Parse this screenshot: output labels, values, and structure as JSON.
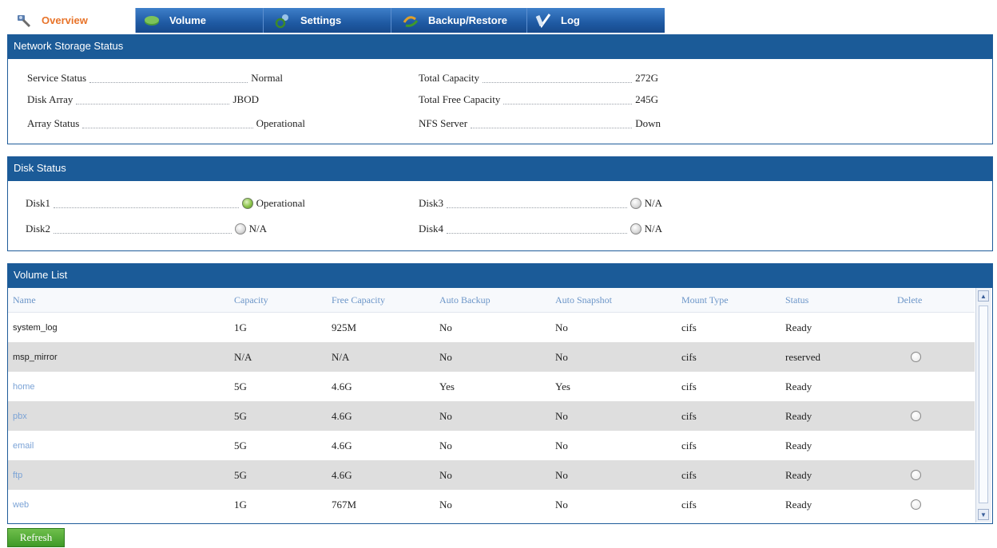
{
  "tabs": [
    {
      "label": "Overview",
      "icon": "wrench-icon",
      "active": true
    },
    {
      "label": "Volume",
      "icon": "disk-icon",
      "active": false
    },
    {
      "label": "Settings",
      "icon": "gears-icon",
      "active": false
    },
    {
      "label": "Backup/Restore",
      "icon": "arrows-icon",
      "active": false
    },
    {
      "label": "Log",
      "icon": "checkmark-icon",
      "active": false
    }
  ],
  "network": {
    "title": "Network Storage Status",
    "service_status": {
      "label": "Service Status",
      "value": "Normal"
    },
    "disk_array": {
      "label": "Disk Array",
      "value": "JBOD"
    },
    "array_status": {
      "label": "Array Status",
      "value": "Operational"
    },
    "total_capacity": {
      "label": "Total Capacity",
      "value": "272G"
    },
    "total_free": {
      "label": "Total Free Capacity",
      "value": "245G"
    },
    "nfs_server": {
      "label": "NFS Server",
      "value": "Down"
    }
  },
  "disks": {
    "title": "Disk Status",
    "disk1": {
      "label": "Disk1",
      "value": "Operational",
      "state": "ok"
    },
    "disk2": {
      "label": "Disk2",
      "value": "N/A",
      "state": "na"
    },
    "disk3": {
      "label": "Disk3",
      "value": "N/A",
      "state": "na"
    },
    "disk4": {
      "label": "Disk4",
      "value": "N/A",
      "state": "na"
    }
  },
  "volumes": {
    "title": "Volume List",
    "columns": [
      "Name",
      "Capacity",
      "Free Capacity",
      "Auto Backup",
      "Auto Snapshot",
      "Mount Type",
      "Status",
      "Delete"
    ],
    "rows": [
      {
        "name": "system_log",
        "capacity": "1G",
        "free": "925M",
        "backup": "No",
        "snapshot": "No",
        "mount": "cifs",
        "status": "Ready",
        "deletable": false
      },
      {
        "name": "msp_mirror",
        "capacity": "N/A",
        "free": "N/A",
        "backup": "No",
        "snapshot": "No",
        "mount": "cifs",
        "status": "reserved",
        "deletable": true
      },
      {
        "name": "home",
        "capacity": "5G",
        "free": "4.6G",
        "backup": "Yes",
        "snapshot": "Yes",
        "mount": "cifs",
        "status": "Ready",
        "deletable": false
      },
      {
        "name": "pbx",
        "capacity": "5G",
        "free": "4.6G",
        "backup": "No",
        "snapshot": "No",
        "mount": "cifs",
        "status": "Ready",
        "deletable": true
      },
      {
        "name": "email",
        "capacity": "5G",
        "free": "4.6G",
        "backup": "No",
        "snapshot": "No",
        "mount": "cifs",
        "status": "Ready",
        "deletable": false
      },
      {
        "name": "ftp",
        "capacity": "5G",
        "free": "4.6G",
        "backup": "No",
        "snapshot": "No",
        "mount": "cifs",
        "status": "Ready",
        "deletable": true
      },
      {
        "name": "web",
        "capacity": "1G",
        "free": "767M",
        "backup": "No",
        "snapshot": "No",
        "mount": "cifs",
        "status": "Ready",
        "deletable": true
      }
    ]
  },
  "refresh_label": "Refresh"
}
